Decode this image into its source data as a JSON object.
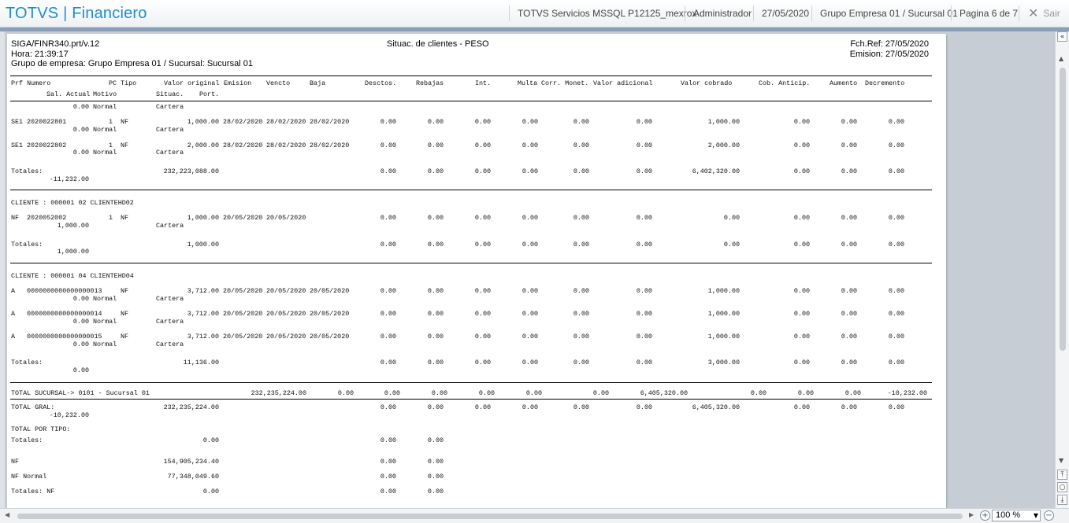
{
  "app": {
    "title": "TOTVS | Financiero",
    "server": "TOTVS Servicios MSSQL P12125_mexrox",
    "user": "Administrador",
    "date": "27/05/2020",
    "company": "Grupo Empresa 01 / Sucursal 01",
    "page": "Pagina 6 de 7",
    "exit_label": "Sair",
    "exit_icon": "✕",
    "accent_color": "#1e8fc6"
  },
  "report": {
    "program": "SIGA/FINR340.prt/v.12",
    "title": "Situac. de clientes  - PESO",
    "fch_ref": "Fch.Ref: 27/05/2020",
    "hora": "Hora: 21:39:17",
    "emision": "Emision: 27/05/2020",
    "grupo": "Grupo de empresa: Grupo Empresa 01 / Sucursal: Sucursal 01",
    "headers": {
      "prf_numero": "Prf Numero",
      "pc_tipo": "PC Tipo",
      "valor_original": "Valor original",
      "emision": "Emision",
      "vencto": "Vencto",
      "baja": "Baja",
      "desctos": "Desctos.",
      "rebajas": "Rebajas",
      "int": "Int.",
      "multa": "Multa",
      "corr_monet": "Corr. Monet.",
      "valor_adicional": "Valor adicional",
      "valor_cobrado": "Valor cobrado",
      "cob_anticip": "Cob. Anticip.",
      "aumento": "Aumento",
      "decremento": "Decremento",
      "sal_actual": "Sal. Actual",
      "motivo": "Motivo",
      "situac": "Situac.",
      "port": "Port."
    },
    "top_row": {
      "saldo": "0.00",
      "motivo": "Normal",
      "situac": "Cartera"
    },
    "section1_rows": [
      {
        "prf": "SE1",
        "numero": "2020022801",
        "pc": "1",
        "tipo": "NF",
        "valor": "1,000.00",
        "emision": "28/02/2020",
        "vencto": "28/02/2020",
        "baja": "28/02/2020",
        "desctos": "0.00",
        "rebajas": "0.00",
        "int": "0.00",
        "multa": "0.00",
        "corr": "0.00",
        "adic": "0.00",
        "cobrado": "1,000.00",
        "anticip": "0.00",
        "aumento": "0.00",
        "decremento": "0.00",
        "saldo": "0.00",
        "motivo": "Normal",
        "situac": "Cartera"
      },
      {
        "prf": "SE1",
        "numero": "2020022802",
        "pc": "1",
        "tipo": "NF",
        "valor": "2,000.00",
        "emision": "28/02/2020",
        "vencto": "28/02/2020",
        "baja": "28/02/2020",
        "desctos": "0.00",
        "rebajas": "0.00",
        "int": "0.00",
        "multa": "0.00",
        "corr": "0.00",
        "adic": "0.00",
        "cobrado": "2,000.00",
        "anticip": "0.00",
        "aumento": "0.00",
        "decremento": "0.00",
        "saldo": "0.00",
        "motivo": "Normal",
        "situac": "Cartera"
      }
    ],
    "section1_total": {
      "label": "Totales:",
      "valor": "232,223,088.00",
      "desctos": "0.00",
      "rebajas": "0.00",
      "int": "0.00",
      "multa": "0.00",
      "corr": "0.00",
      "adic": "0.00",
      "cobrado": "6,402,320.00",
      "anticip": "0.00",
      "aumento": "0.00",
      "decremento": "0.00",
      "saldo": "-11,232.00"
    },
    "client2": {
      "header": "CLIENTE :  000001 02     CLIENTEHD02",
      "row": {
        "prf": "NF",
        "numero": "2020052002",
        "pc": "1",
        "tipo": "NF",
        "valor": "1,000.00",
        "emision": "20/05/2020",
        "vencto": "20/05/2020",
        "desctos": "0.00",
        "rebajas": "0.00",
        "int": "0.00",
        "multa": "0.00",
        "corr": "0.00",
        "adic": "0.00",
        "cobrado": "0.00",
        "anticip": "0.00",
        "aumento": "0.00",
        "decremento": "0.00",
        "saldo": "1,000.00",
        "situac": "Cartera"
      },
      "total": {
        "label": "Totales:",
        "valor": "1,000.00",
        "desctos": "0.00",
        "rebajas": "0.00",
        "int": "0.00",
        "multa": "0.00",
        "corr": "0.00",
        "adic": "0.00",
        "cobrado": "0.00",
        "anticip": "0.00",
        "aumento": "0.00",
        "decremento": "0.00",
        "saldo": "1,000.00"
      }
    },
    "client4": {
      "header": "CLIENTE :  000001 04     CLIENTEHD04",
      "rows": [
        {
          "prf": "A",
          "numero": "0000000000000000013",
          "tipo": "NF",
          "valor": "3,712.00",
          "emision": "20/05/2020",
          "vencto": "20/05/2020",
          "baja": "20/05/2020",
          "desctos": "0.00",
          "rebajas": "0.00",
          "int": "0.00",
          "multa": "0.00",
          "corr": "0.00",
          "adic": "0.00",
          "cobrado": "1,000.00",
          "anticip": "0.00",
          "aumento": "0.00",
          "decremento": "0.00",
          "saldo": "0.00",
          "motivo": "Normal",
          "situac": "Cartera"
        },
        {
          "prf": "A",
          "numero": "0000000000000000014",
          "tipo": "NF",
          "valor": "3,712.00",
          "emision": "20/05/2020",
          "vencto": "20/05/2020",
          "baja": "20/05/2020",
          "desctos": "0.00",
          "rebajas": "0.00",
          "int": "0.00",
          "multa": "0.00",
          "corr": "0.00",
          "adic": "0.00",
          "cobrado": "1,000.00",
          "anticip": "0.00",
          "aumento": "0.00",
          "decremento": "0.00",
          "saldo": "0.00",
          "motivo": "Normal",
          "situac": "Cartera"
        },
        {
          "prf": "A",
          "numero": "0000000000000000015",
          "tipo": "NF",
          "valor": "3,712.00",
          "emision": "20/05/2020",
          "vencto": "20/05/2020",
          "baja": "20/05/2020",
          "desctos": "0.00",
          "rebajas": "0.00",
          "int": "0.00",
          "multa": "0.00",
          "corr": "0.00",
          "adic": "0.00",
          "cobrado": "1,000.00",
          "anticip": "0.00",
          "aumento": "0.00",
          "decremento": "0.00",
          "saldo": "0.00",
          "motivo": "Normal",
          "situac": "Cartera"
        }
      ],
      "total": {
        "label": "Totales:",
        "valor": "11,136.00",
        "desctos": "0.00",
        "rebajas": "0.00",
        "int": "0.00",
        "multa": "0.00",
        "corr": "0.00",
        "adic": "0.00",
        "cobrado": "3,000.00",
        "anticip": "0.00",
        "aumento": "0.00",
        "decremento": "0.00",
        "saldo": "0.00"
      }
    },
    "total_sucursal": {
      "label": "TOTAL SUCURSAL->  0101 - Sucursal 01",
      "valor": "232,235,224.00",
      "v1": "0.00",
      "v2": "0.00",
      "v3": "0.00",
      "v4": "0.00",
      "v5": "0.00",
      "v6": "0.00",
      "cobrado": "6,405,320.00",
      "v8": "0.00",
      "v9": "0.00",
      "v10": "0.00",
      "decremento": "-10,232.00"
    },
    "total_gral": {
      "label": "TOTAL GRAL:",
      "valor": "232,235,224.00",
      "desctos": "0.00",
      "rebajas": "0.00",
      "int": "0.00",
      "multa": "0.00",
      "corr": "0.00",
      "adic": "0.00",
      "cobrado": "6,405,320.00",
      "anticip": "0.00",
      "aumento": "0.00",
      "decremento": "0.00",
      "saldo": "-10,232.00"
    },
    "por_tipo": {
      "label": "TOTAL POR TIPO:",
      "rows": [
        {
          "label": "Totales:",
          "valor": "0.00",
          "desctos": "0.00",
          "rebajas": "0.00"
        },
        {
          "label": "NF",
          "valor": "154,905,234.40",
          "desctos": "0.00",
          "rebajas": "0.00"
        },
        {
          "label": "NF    Normal",
          "valor": "77,348,049.60",
          "desctos": "0.00",
          "rebajas": "0.00"
        },
        {
          "label": "Totales: NF",
          "valor": "0.00",
          "desctos": "0.00",
          "rebajas": "0.00"
        }
      ]
    }
  },
  "viewer": {
    "zoom": "100 %",
    "zoom_in_icon": "+",
    "zoom_out_icon": "−",
    "collapse_icon": "«",
    "scroll_top_icon": "⤒",
    "scroll_center_icon": "○",
    "scroll_bottom_icon": "⤓"
  }
}
